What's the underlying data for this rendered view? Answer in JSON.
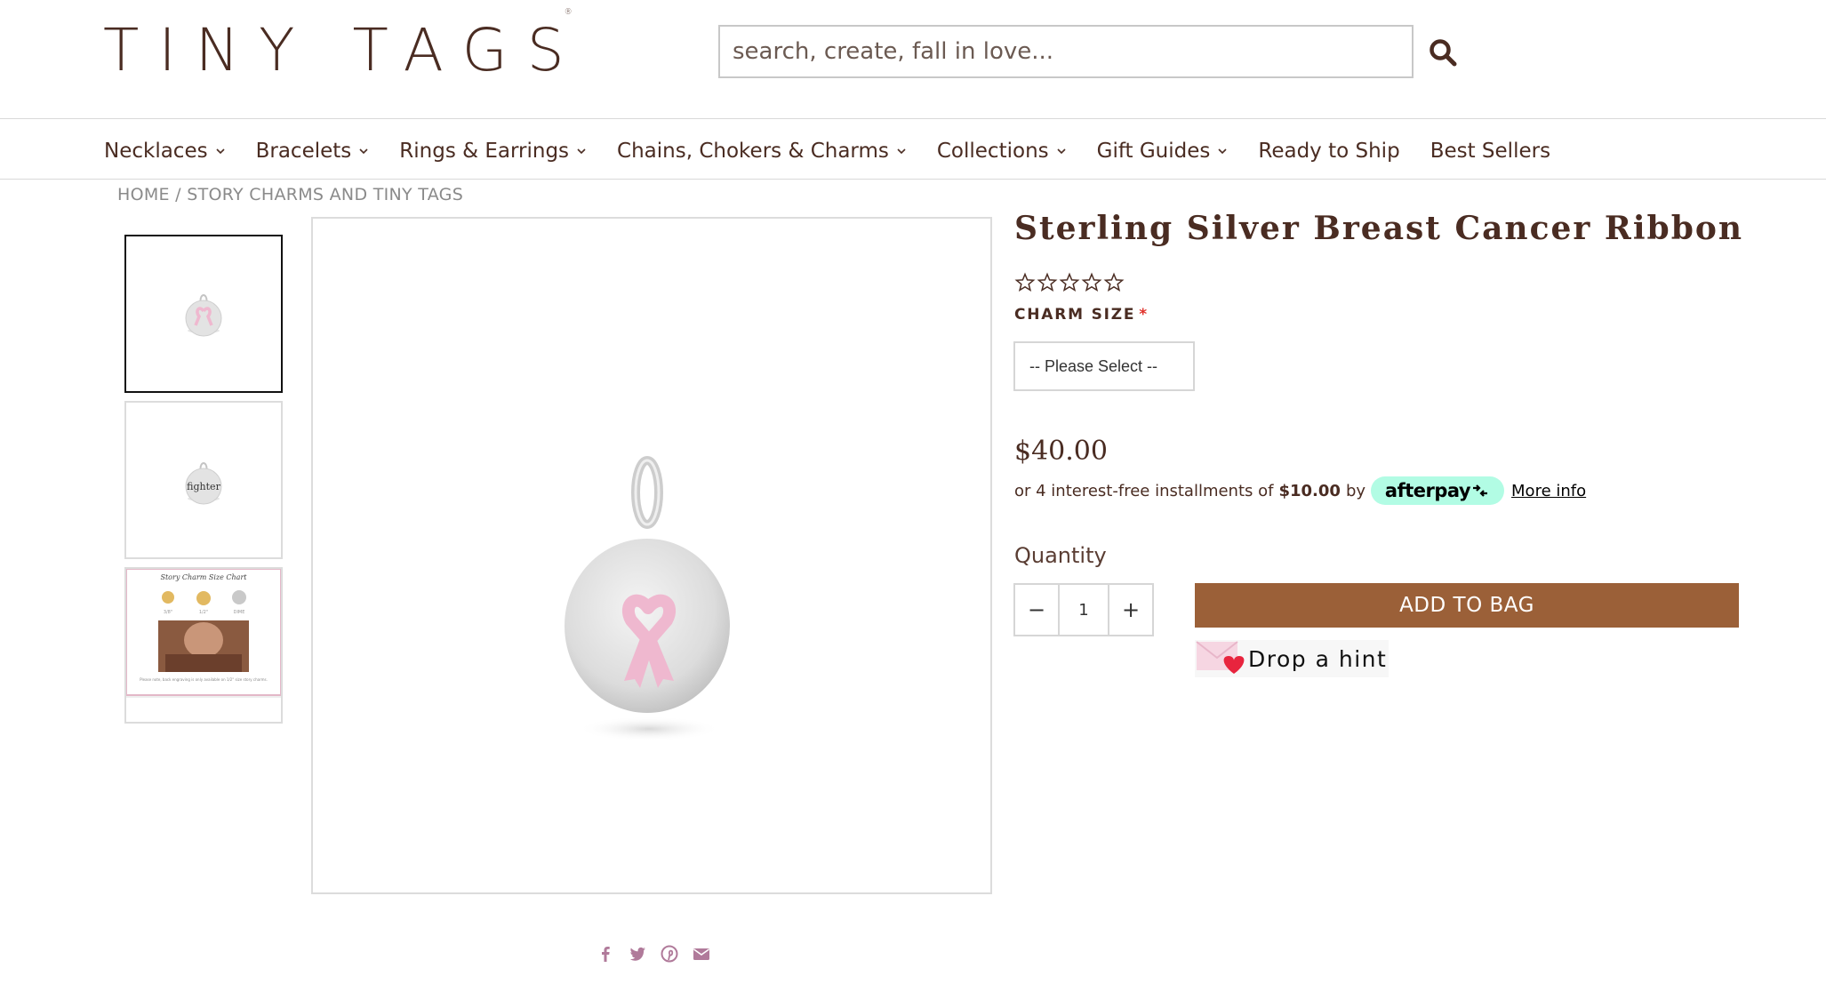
{
  "header": {
    "logo": "TINY TAGS",
    "logo_mark": "®",
    "search_placeholder": "search, create, fall in love..."
  },
  "nav": [
    {
      "label": "Necklaces",
      "has_dropdown": true
    },
    {
      "label": "Bracelets",
      "has_dropdown": true
    },
    {
      "label": "Rings & Earrings",
      "has_dropdown": true
    },
    {
      "label": "Chains, Chokers & Charms",
      "has_dropdown": true
    },
    {
      "label": "Collections",
      "has_dropdown": true
    },
    {
      "label": "Gift Guides",
      "has_dropdown": true
    },
    {
      "label": "Ready to Ship",
      "has_dropdown": false
    },
    {
      "label": "Best Sellers",
      "has_dropdown": false
    }
  ],
  "breadcrumb": {
    "home": "HOME",
    "separator": " / ",
    "current": "STORY CHARMS AND TINY TAGS"
  },
  "thumbnails": {
    "engraving_text": "fighter",
    "size_chart_title": "Story Charm Size Chart",
    "size_chart_sizes": [
      "3/8\"",
      "1/2\"",
      "DIME"
    ],
    "size_chart_note": "Please note, back engraving is only available on 1/2\" size story charms."
  },
  "product": {
    "title": "Sterling Silver Breast Cancer Ribbon",
    "rating": 0,
    "rating_max": 5,
    "size_label": "CHARM SIZE",
    "required_mark": "*",
    "size_select": "-- Please Select --",
    "price": "$40.00",
    "installments_prefix": "or 4 interest-free installments of",
    "installment_amount": "$10.00",
    "installments_by": "by",
    "afterpay": "afterpay",
    "more_info": "More info",
    "quantity_label": "Quantity",
    "quantity_minus": "−",
    "quantity_value": "1",
    "quantity_plus": "+",
    "add_to_bag": "ADD TO BAG",
    "drop_hint": "Drop a hint"
  },
  "colors": {
    "brand_brown": "#4a2c22",
    "add_to_bag": "#9b6038",
    "afterpay_mint": "#b2fce4",
    "ribbon_pink": "#efb8cf",
    "share_icons": "#b07a9a"
  },
  "share_icons": [
    "facebook-icon",
    "twitter-icon",
    "pinterest-icon",
    "email-icon"
  ]
}
